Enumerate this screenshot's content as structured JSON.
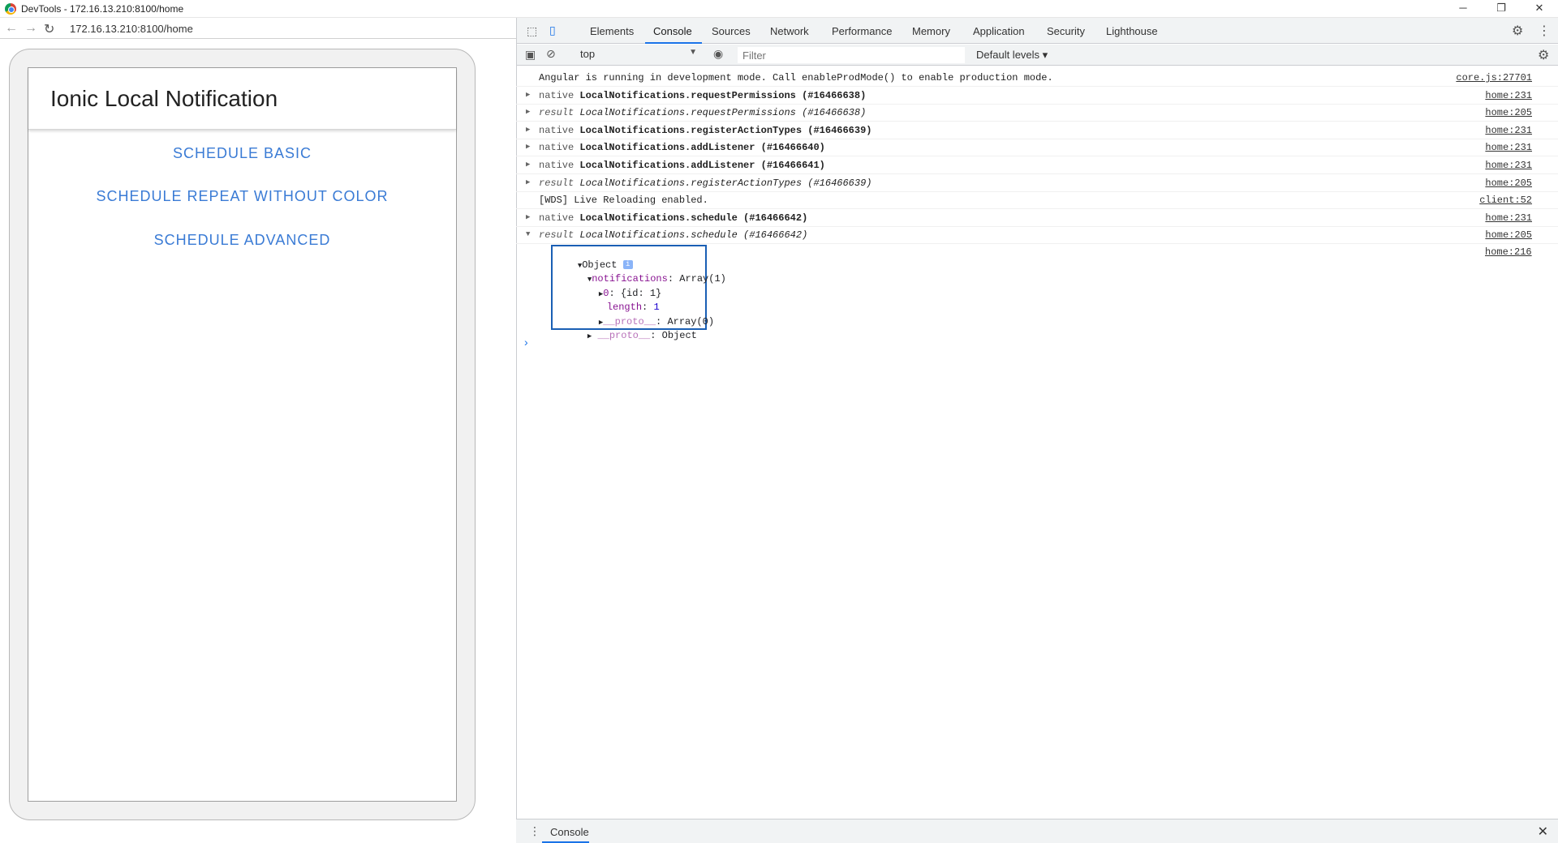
{
  "window": {
    "title": "DevTools - 172.16.13.210:8100/home",
    "minimize": "─",
    "restore": "❐",
    "close": "✕"
  },
  "browser": {
    "url": "172.16.13.210:8100/home"
  },
  "app": {
    "title": "Ionic Local Notification",
    "buttons": [
      "SCHEDULE BASIC",
      "SCHEDULE REPEAT WITHOUT COLOR",
      "SCHEDULE ADVANCED"
    ]
  },
  "devtools": {
    "tabs": [
      "Elements",
      "Console",
      "Sources",
      "Network",
      "Performance",
      "Memory",
      "Application",
      "Security",
      "Lighthouse"
    ],
    "active_tab": "Console",
    "context": "top",
    "filter_placeholder": "Filter",
    "levels": "Default levels ▾",
    "drawer_tab": "Console"
  },
  "console": {
    "rows": [
      {
        "kind": "",
        "call": "Angular is running in development mode. Call enableProdMode() to enable production mode.",
        "src": "core.js:27701",
        "expandable": false,
        "result": false
      },
      {
        "kind": "native",
        "call": "LocalNotifications.requestPermissions (#16466638)",
        "src": "home:231",
        "expandable": true,
        "result": false
      },
      {
        "kind": "result",
        "call": "LocalNotifications.requestPermissions (#16466638)",
        "src": "home:205",
        "expandable": true,
        "result": true
      },
      {
        "kind": "native",
        "call": "LocalNotifications.registerActionTypes (#16466639)",
        "src": "home:231",
        "expandable": true,
        "result": false
      },
      {
        "kind": "native",
        "call": "LocalNotifications.addListener (#16466640)",
        "src": "home:231",
        "expandable": true,
        "result": false
      },
      {
        "kind": "native",
        "call": "LocalNotifications.addListener (#16466641)",
        "src": "home:231",
        "expandable": true,
        "result": false
      },
      {
        "kind": "result",
        "call": "LocalNotifications.registerActionTypes (#16466639)",
        "src": "home:205",
        "expandable": true,
        "result": true
      },
      {
        "kind": "",
        "call": "[WDS] Live Reloading enabled.",
        "src": "client:52",
        "expandable": false,
        "result": false
      },
      {
        "kind": "native",
        "call": "LocalNotifications.schedule (#16466642)",
        "src": "home:231",
        "expandable": true,
        "result": false
      },
      {
        "kind": "result",
        "call": "LocalNotifications.schedule (#16466642)",
        "src": "home:205",
        "expandable": true,
        "result": true,
        "expanded": true
      }
    ],
    "object_src": "home:216",
    "object": {
      "root": "Object",
      "info": "i",
      "notifications_key": "notifications",
      "notifications_val": "Array(1)",
      "item0_key": "0",
      "item0_val": "{id: 1}",
      "length_key": "length",
      "length_val": "1",
      "proto_key": "__proto__",
      "proto_arr_val": "Array(0)",
      "proto_obj_val": "Object"
    },
    "prompt": "›"
  }
}
